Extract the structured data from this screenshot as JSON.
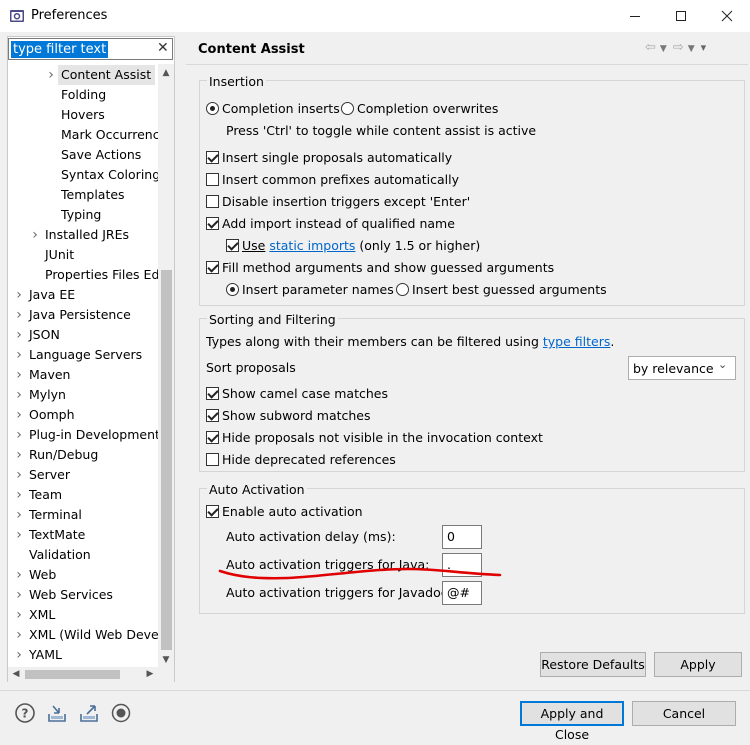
{
  "window": {
    "title": "Preferences",
    "icon": "eclipse-gear-icon"
  },
  "filter": {
    "text": "type filter text",
    "clear_glyph": "✕"
  },
  "tree": {
    "items": [
      {
        "label": "Content Assist",
        "arrow": ">",
        "selected": true
      },
      {
        "label": "Folding"
      },
      {
        "label": "Hovers"
      },
      {
        "label": "Mark Occurrence"
      },
      {
        "label": "Save Actions"
      },
      {
        "label": "Syntax Coloring"
      },
      {
        "label": "Templates"
      },
      {
        "label": "Typing"
      },
      {
        "label": "Installed JREs",
        "arrow": ">"
      },
      {
        "label": "JUnit"
      },
      {
        "label": "Properties Files Edi"
      },
      {
        "label": "Java EE",
        "arrow": ">"
      },
      {
        "label": "Java Persistence",
        "arrow": ">"
      },
      {
        "label": "JSON",
        "arrow": ">"
      },
      {
        "label": "Language Servers",
        "arrow": ">"
      },
      {
        "label": "Maven",
        "arrow": ">"
      },
      {
        "label": "Mylyn",
        "arrow": ">"
      },
      {
        "label": "Oomph",
        "arrow": ">"
      },
      {
        "label": "Plug-in Development",
        "arrow": ">"
      },
      {
        "label": "Run/Debug",
        "arrow": ">"
      },
      {
        "label": "Server",
        "arrow": ">"
      },
      {
        "label": "Team",
        "arrow": ">"
      },
      {
        "label": "Terminal",
        "arrow": ">"
      },
      {
        "label": "TextMate",
        "arrow": ">"
      },
      {
        "label": "Validation"
      },
      {
        "label": "Web",
        "arrow": ">"
      },
      {
        "label": "Web Services",
        "arrow": ">"
      },
      {
        "label": "XML",
        "arrow": ">"
      },
      {
        "label": "XML (Wild Web Devel",
        "arrow": ">"
      },
      {
        "label": "YAML",
        "arrow": ">"
      }
    ]
  },
  "page": {
    "title": "Content Assist"
  },
  "insertion": {
    "title": "Insertion",
    "completion_inserts": "Completion inserts",
    "completion_overwrites": "Completion overwrites",
    "toggle_hint": "Press 'Ctrl' to toggle while content assist is active",
    "insert_single": "Insert single proposals automatically",
    "insert_prefixes": "Insert common prefixes automatically",
    "disable_triggers": "Disable insertion triggers except 'Enter'",
    "add_import": "Add import instead of qualified name",
    "use_label": "Use",
    "static_imports": "static imports",
    "only_15": "(only 1.5 or higher)",
    "fill_method": "Fill method arguments and show guessed arguments",
    "insert_param_names": "Insert parameter names",
    "insert_best_guessed": "Insert best guessed arguments"
  },
  "sorting": {
    "title": "Sorting and Filtering",
    "types_text": "Types along with their members can be filtered using",
    "type_filters": "type filters",
    "period": ".",
    "sort_proposals": "Sort proposals",
    "sort_value": "by relevance",
    "camel_case": "Show camel case matches",
    "subword": "Show subword matches",
    "hide_not_visible": "Hide proposals not visible in the invocation context",
    "hide_deprecated": "Hide deprecated references"
  },
  "auto": {
    "title": "Auto Activation",
    "enable": "Enable auto activation",
    "delay_label": "Auto activation delay (ms):",
    "delay_value": "0",
    "java_label": "Auto activation triggers for Java:",
    "java_value": ".",
    "javadoc_label": "Auto activation triggers for Javadoc:",
    "javadoc_value": "@#"
  },
  "buttons": {
    "restore_defaults": "Restore Defaults",
    "apply": "Apply",
    "apply_close": "Apply and Close",
    "cancel": "Cancel"
  },
  "colors": {
    "accent": "#0078d7",
    "link": "#0066cc",
    "annotation": "#e00000"
  }
}
